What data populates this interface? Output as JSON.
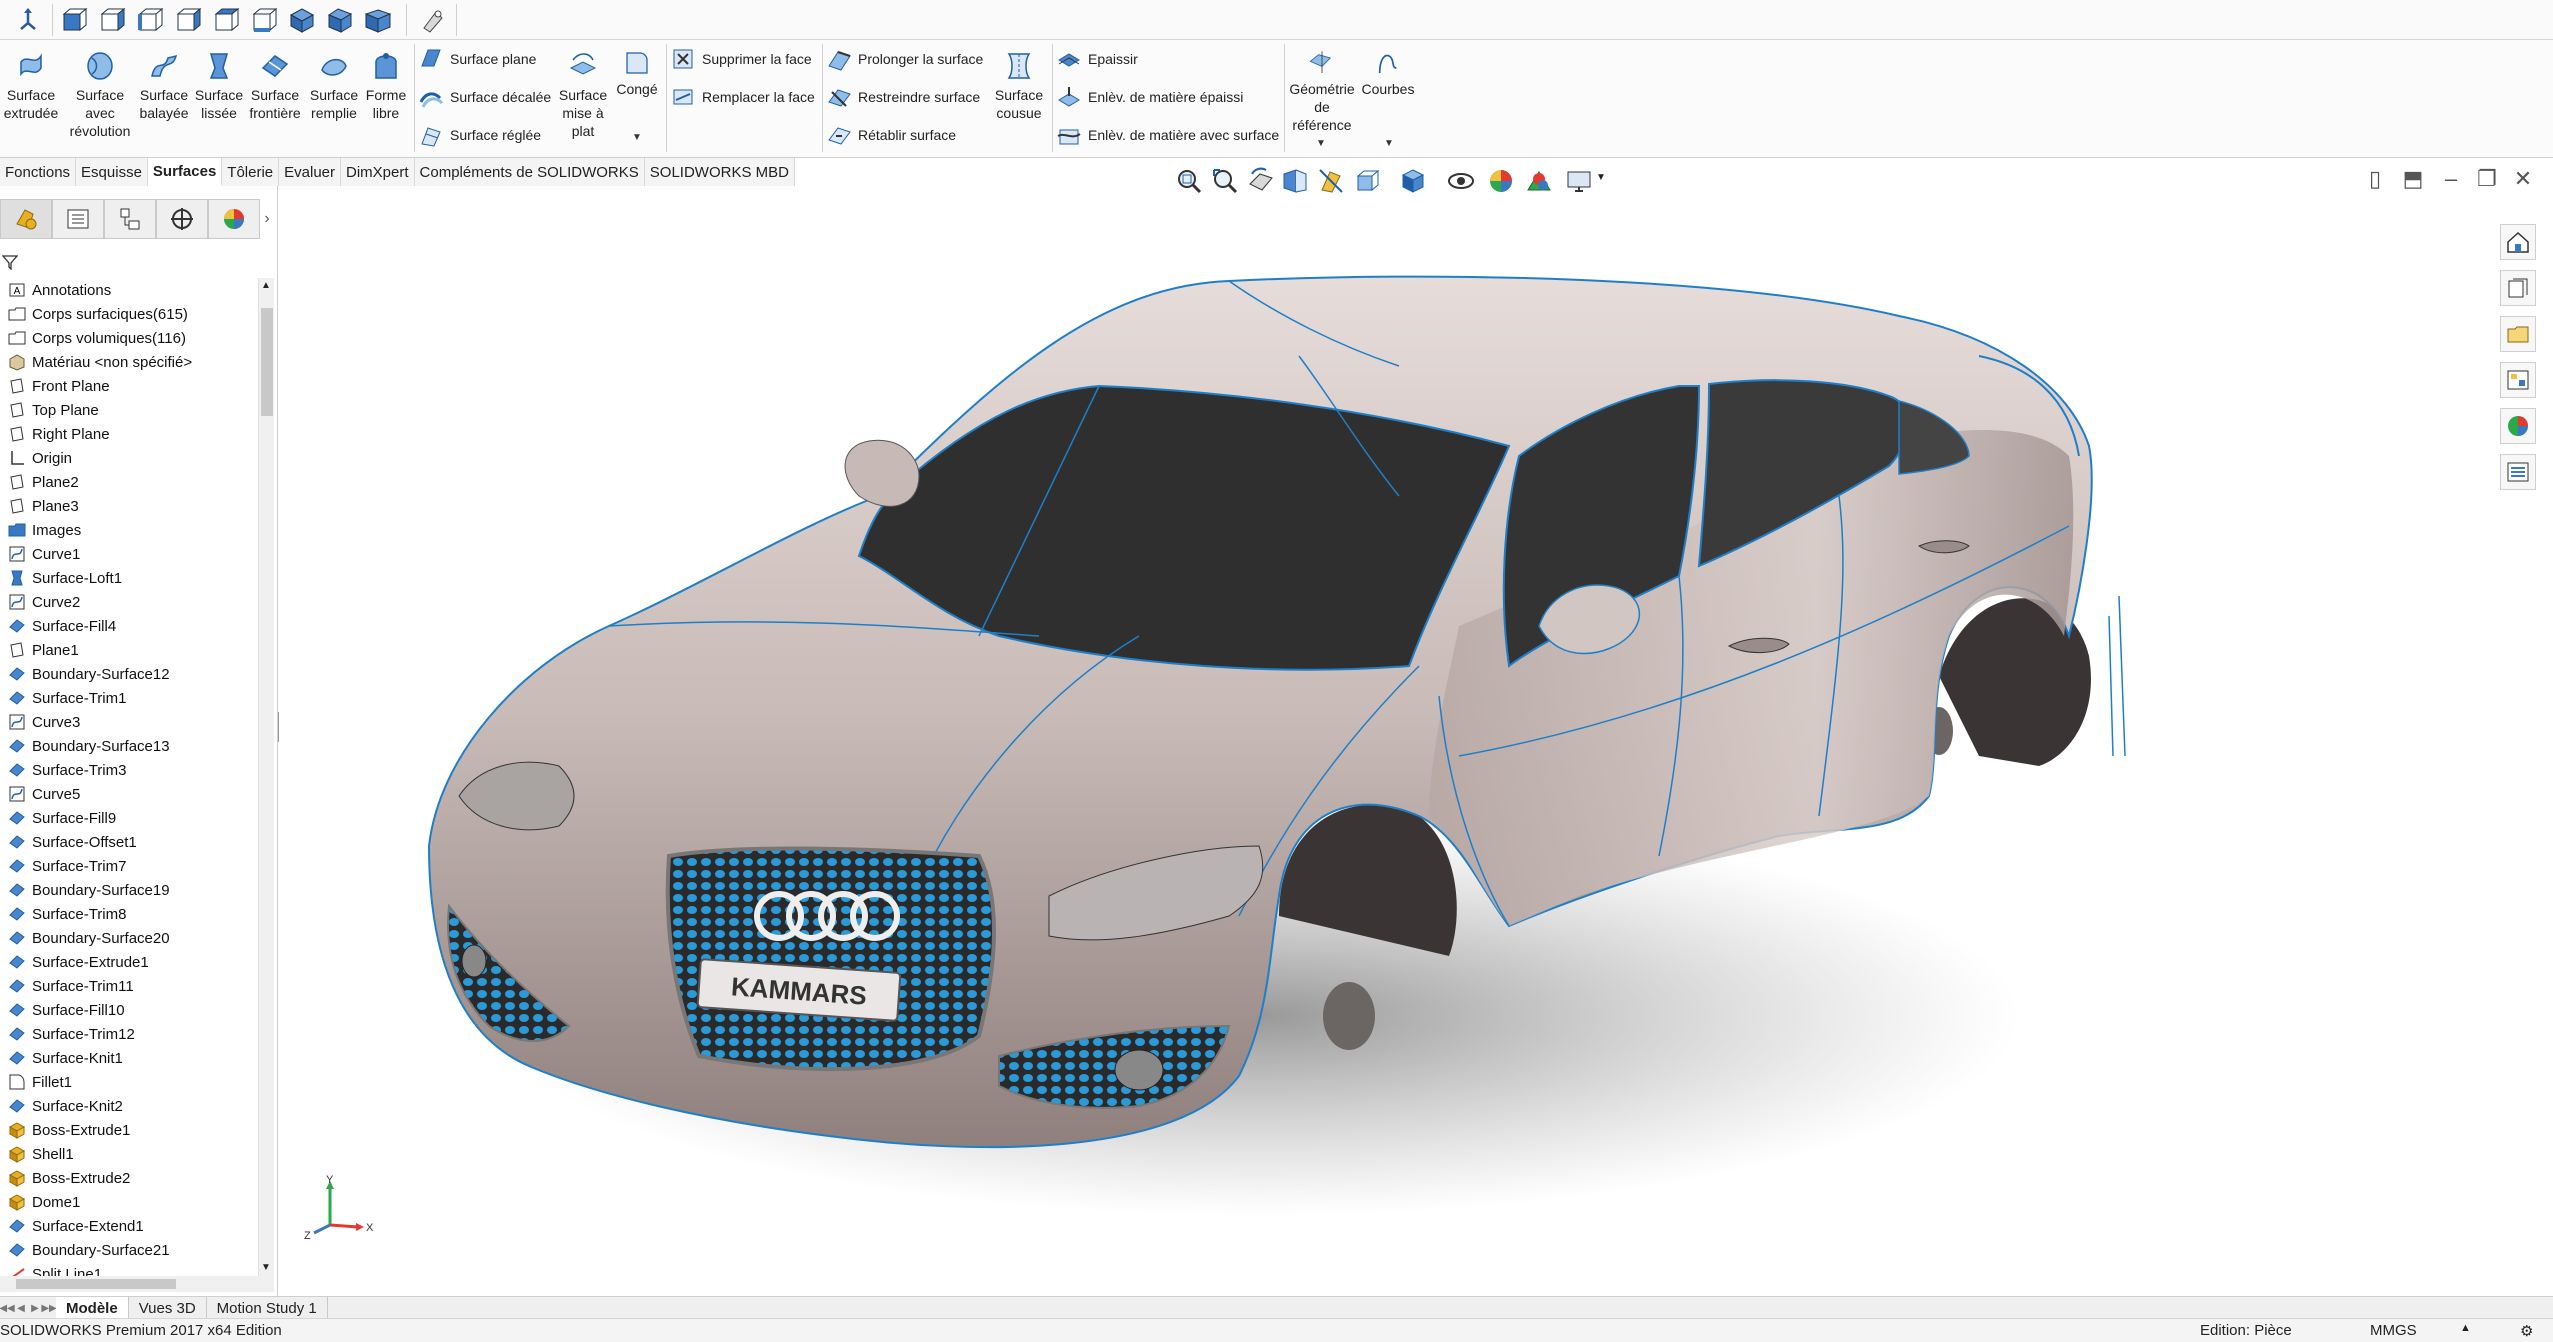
{
  "quick_toolbar": {
    "icons": [
      "normal-to-icon",
      "front-view-icon",
      "back-view-icon",
      "left-view-icon",
      "right-view-icon",
      "top-view-icon",
      "bottom-view-icon",
      "isometric-view-icon",
      "trimetric-view-icon",
      "dimetric-view-icon",
      "view-selector-icon"
    ]
  },
  "ribbon": {
    "big_buttons": [
      {
        "id": "surface-extruded",
        "label": "Surface\nextrudée"
      },
      {
        "id": "surface-revolved",
        "label": "Surface\navec\nrévolution"
      },
      {
        "id": "surface-swept",
        "label": "Surface\nbalayée"
      },
      {
        "id": "surface-lofted",
        "label": "Surface\nlissée"
      },
      {
        "id": "surface-boundary",
        "label": "Surface\nfrontière"
      },
      {
        "id": "surface-filled",
        "label": "Surface\nremplie"
      },
      {
        "id": "freeform",
        "label": "Forme\nlibre"
      }
    ],
    "col1": [
      "Surface plane",
      "Surface décalée",
      "Surface réglée"
    ],
    "flatten": "Surface\nmise à\nplat",
    "fillet": "Congé",
    "col2": [
      "Supprimer la face",
      "Remplacer la face"
    ],
    "col3": [
      "Prolonger la surface",
      "Restreindre surface",
      "Rétablir surface"
    ],
    "knit": "Surface\ncousue",
    "col4": [
      "Epaissir",
      "Enlèv. de matière épaissi",
      "Enlèv. de matière avec surface"
    ],
    "ref_geometry": "Géométrie\nde\nréférence",
    "curves": "Courbes"
  },
  "tabs": [
    "Fonctions",
    "Esquisse",
    "Surfaces",
    "Tôlerie",
    "Evaluer",
    "DimXpert",
    "Compléments de SOLIDWORKS",
    "SOLIDWORKS MBD"
  ],
  "active_tab": "Surfaces",
  "tree": [
    {
      "label": "Annotations",
      "icon": "annotations"
    },
    {
      "label": "Corps surfaciques(615)",
      "icon": "folder"
    },
    {
      "label": "Corps volumiques(116)",
      "icon": "folder"
    },
    {
      "label": "Matériau <non spécifié>",
      "icon": "material"
    },
    {
      "label": "Front Plane",
      "icon": "plane"
    },
    {
      "label": "Top Plane",
      "icon": "plane"
    },
    {
      "label": "Right Plane",
      "icon": "plane"
    },
    {
      "label": "Origin",
      "icon": "origin"
    },
    {
      "label": "Plane2",
      "icon": "plane"
    },
    {
      "label": "Plane3",
      "icon": "plane"
    },
    {
      "label": "Images",
      "icon": "folder-blue"
    },
    {
      "label": "Curve1",
      "icon": "curve"
    },
    {
      "label": "Surface-Loft1",
      "icon": "loft"
    },
    {
      "label": "Curve2",
      "icon": "curve"
    },
    {
      "label": "Surface-Fill4",
      "icon": "surface"
    },
    {
      "label": "Plane1",
      "icon": "plane"
    },
    {
      "label": "Boundary-Surface12",
      "icon": "surface"
    },
    {
      "label": "Surface-Trim1",
      "icon": "surface"
    },
    {
      "label": "Curve3",
      "icon": "curve"
    },
    {
      "label": "Boundary-Surface13",
      "icon": "surface"
    },
    {
      "label": "Surface-Trim3",
      "icon": "surface"
    },
    {
      "label": "Curve5",
      "icon": "curve"
    },
    {
      "label": "Surface-Fill9",
      "icon": "surface"
    },
    {
      "label": "Surface-Offset1",
      "icon": "surface"
    },
    {
      "label": "Surface-Trim7",
      "icon": "surface"
    },
    {
      "label": "Boundary-Surface19",
      "icon": "surface"
    },
    {
      "label": "Surface-Trim8",
      "icon": "surface"
    },
    {
      "label": "Boundary-Surface20",
      "icon": "surface"
    },
    {
      "label": "Surface-Extrude1",
      "icon": "surface"
    },
    {
      "label": "Surface-Trim11",
      "icon": "surface"
    },
    {
      "label": "Surface-Fill10",
      "icon": "surface"
    },
    {
      "label": "Surface-Trim12",
      "icon": "surface"
    },
    {
      "label": "Surface-Knit1",
      "icon": "surface"
    },
    {
      "label": "Fillet1",
      "icon": "fillet"
    },
    {
      "label": "Surface-Knit2",
      "icon": "surface"
    },
    {
      "label": "Boss-Extrude1",
      "icon": "solid"
    },
    {
      "label": "Shell1",
      "icon": "solid"
    },
    {
      "label": "Boss-Extrude2",
      "icon": "solid"
    },
    {
      "label": "Dome1",
      "icon": "solid"
    },
    {
      "label": "Surface-Extend1",
      "icon": "surface"
    },
    {
      "label": "Boundary-Surface21",
      "icon": "surface"
    },
    {
      "label": "Split Line1",
      "icon": "split"
    }
  ],
  "bottom_tabs": [
    "Modèle",
    "Vues 3D",
    "Motion Study 1"
  ],
  "active_bottom_tab": "Modèle",
  "status": {
    "app": "SOLIDWORKS Premium 2017 x64 Edition",
    "mode": "Edition: Pièce",
    "units": "MMGS"
  },
  "model": {
    "badge_text": "KAMMARS",
    "body_color": "#c9bbb7",
    "glass_color": "#2f2f2f",
    "edge_color": "#1e7fc8",
    "grille_color": "#1f8fd1"
  },
  "triad_labels": {
    "x": "X",
    "y": "Y",
    "z": "Z"
  }
}
